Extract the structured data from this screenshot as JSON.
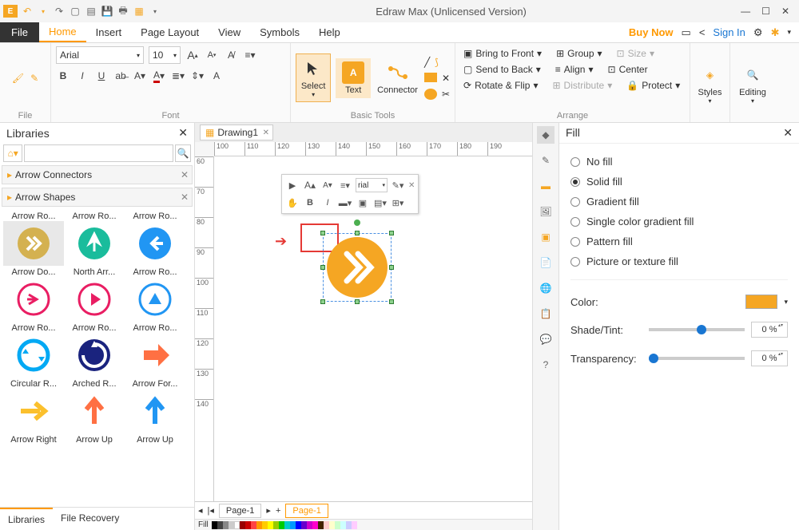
{
  "app": {
    "title": "Edraw Max (Unlicensed Version)"
  },
  "menubar": {
    "file": "File",
    "tabs": [
      "Home",
      "Insert",
      "Page Layout",
      "View",
      "Symbols",
      "Help"
    ],
    "active": "Home",
    "buy": "Buy Now",
    "signin": "Sign In"
  },
  "ribbon": {
    "file_group": "File",
    "font_group": "Font",
    "font_name": "Arial",
    "font_size": "10",
    "basic_tools": "Basic Tools",
    "select": "Select",
    "text": "Text",
    "connector": "Connector",
    "arrange_group": "Arrange",
    "bring_front": "Bring to Front",
    "send_back": "Send to Back",
    "rotate": "Rotate & Flip",
    "group": "Group",
    "align": "Align",
    "distribute": "Distribute",
    "size": "Size",
    "center": "Center",
    "protect": "Protect",
    "styles": "Styles",
    "editing": "Editing"
  },
  "libraries": {
    "title": "Libraries",
    "sections": [
      "Arrow Connectors",
      "Arrow Shapes"
    ],
    "row1": [
      "Arrow Ro...",
      "Arrow Ro...",
      "Arrow Ro..."
    ],
    "row2": [
      "Arrow Do...",
      "North Arr...",
      "Arrow Ro..."
    ],
    "row3": [
      "Arrow Ro...",
      "Arrow Ro...",
      "Arrow Ro..."
    ],
    "row4": [
      "Circular R...",
      "Arched R...",
      "Arrow For..."
    ],
    "row5": [
      "Arrow Right",
      "Arrow Up",
      "Arrow Up"
    ],
    "tab_lib": "Libraries",
    "tab_recovery": "File Recovery"
  },
  "doc": {
    "name": "Drawing1",
    "page": "Page-1",
    "fill_label": "Fill"
  },
  "ruler": [
    "100",
    "110",
    "120",
    "130",
    "140",
    "150",
    "160",
    "170",
    "180",
    "190"
  ],
  "ruler_v": [
    "60",
    "70",
    "80",
    "90",
    "100",
    "110",
    "120",
    "130",
    "140"
  ],
  "mini_font": "rial",
  "fill_panel": {
    "title": "Fill",
    "no_fill": "No fill",
    "solid_fill": "Solid fill",
    "gradient_fill": "Gradient fill",
    "single_grad": "Single color gradient fill",
    "pattern_fill": "Pattern fill",
    "picture_fill": "Picture or texture fill",
    "color": "Color:",
    "shade": "Shade/Tint:",
    "transparency": "Transparency:",
    "shade_val": "0 %",
    "trans_val": "0 %"
  }
}
